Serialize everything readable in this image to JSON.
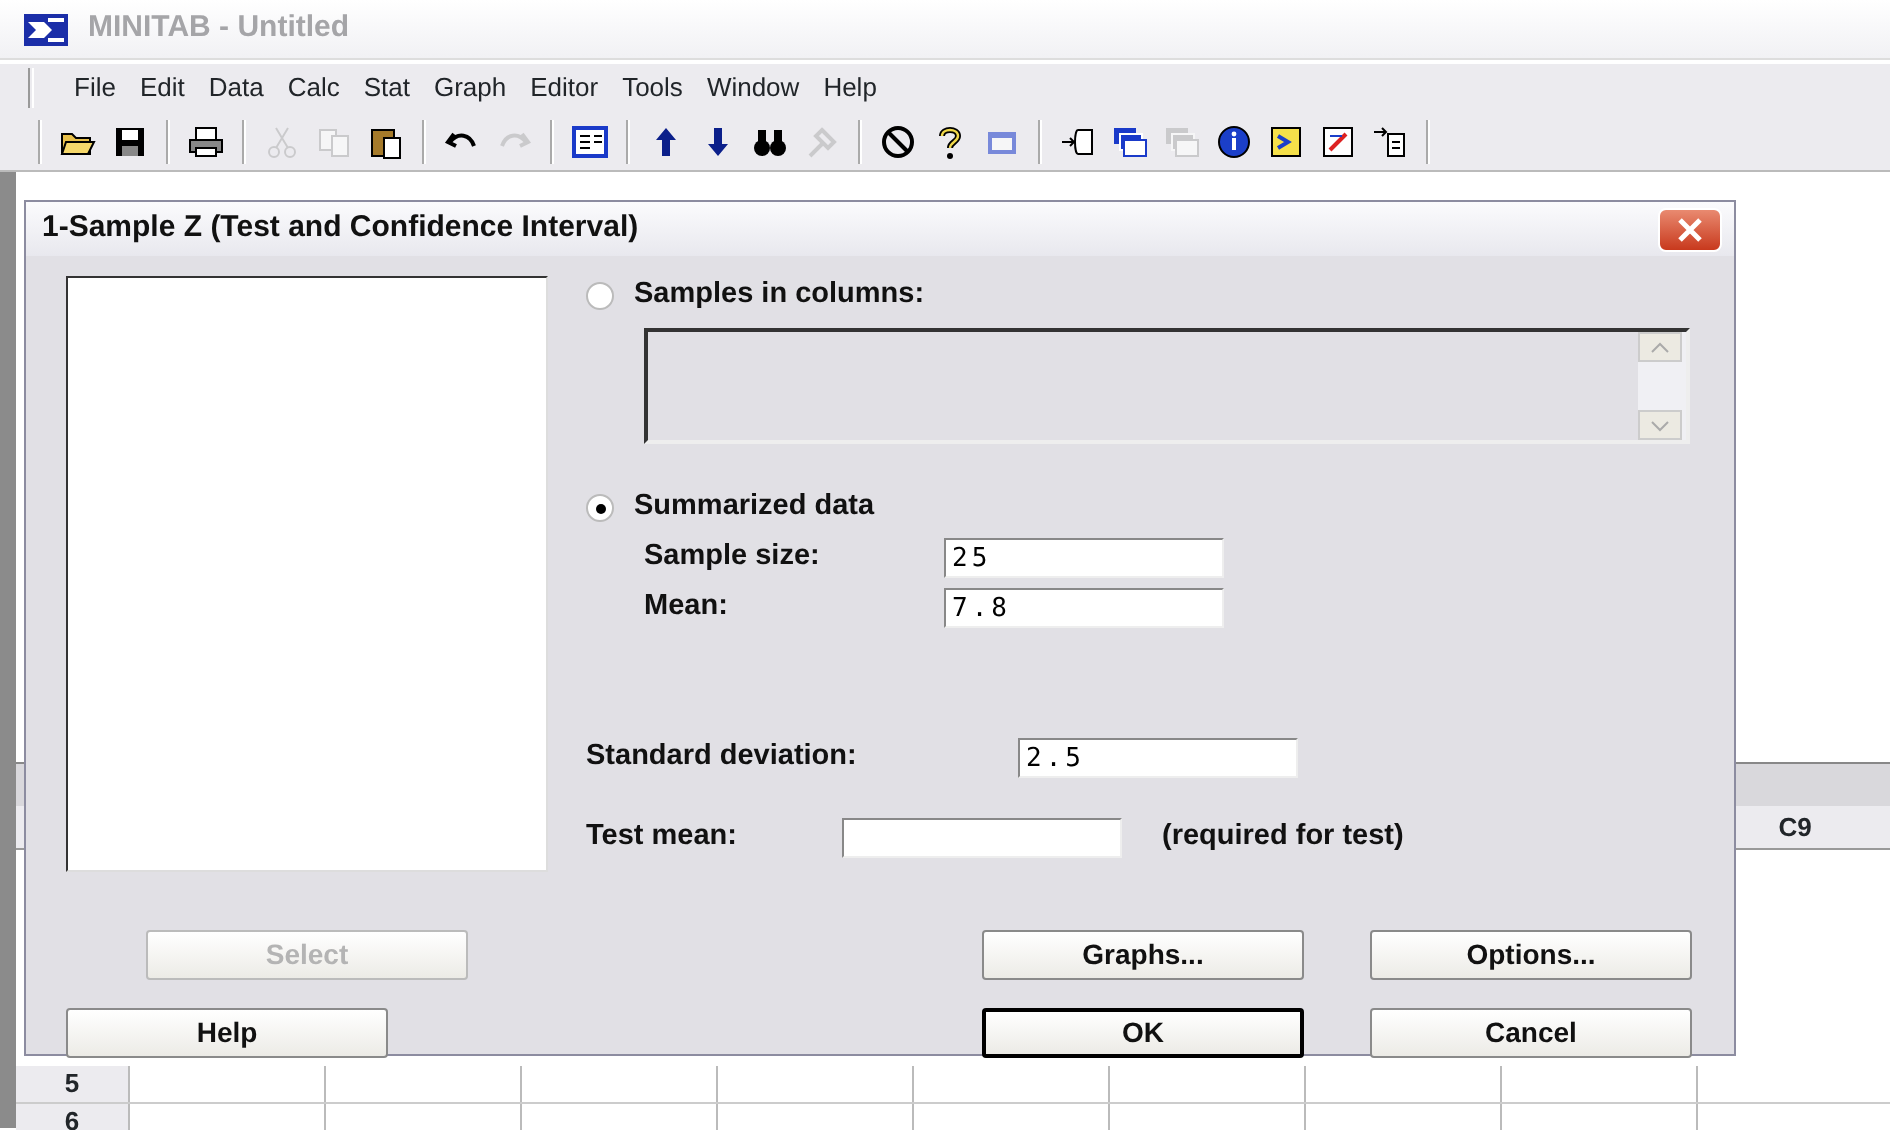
{
  "app_window": {
    "title": "MINITAB - Untitled"
  },
  "menu": [
    "File",
    "Edit",
    "Data",
    "Calc",
    "Stat",
    "Graph",
    "Editor",
    "Tools",
    "Window",
    "Help"
  ],
  "toolbar": [
    {
      "disabled": false
    },
    {
      "disabled": false
    },
    {
      "disabled": false
    },
    {
      "disabled": true
    },
    {
      "disabled": true
    },
    {
      "disabled": false
    },
    {
      "disabled": false
    },
    {
      "disabled": true
    },
    {
      "disabled": false
    },
    {
      "disabled": false
    },
    {
      "disabled": false
    },
    {
      "disabled": false
    },
    {
      "disabled": true
    },
    {
      "disabled": false
    },
    {
      "disabled": false
    },
    {
      "disabled": true
    },
    {
      "disabled": false
    },
    {
      "disabled": false
    },
    {
      "disabled": true
    },
    {
      "disabled": false
    },
    {
      "disabled": false
    },
    {
      "disabled": false
    },
    {
      "disabled": false
    }
  ],
  "worksheet": {
    "column_header": "C9",
    "row_labels": [
      "5",
      "6"
    ]
  },
  "dialog": {
    "title": "1-Sample Z (Test and Confidence Interval)",
    "options": [
      {
        "label": "Samples in columns:",
        "selected": false
      },
      {
        "label": "Summarized data",
        "selected": true
      }
    ],
    "sample_size": {
      "label": "Sample size:",
      "value": "25"
    },
    "mean": {
      "label": "Mean:",
      "value": "7.8"
    },
    "standard_deviation": {
      "label": "Standard deviation:",
      "value": "2.5"
    },
    "test_mean": {
      "label": "Test mean:",
      "note": "(required for test)"
    },
    "buttons": [
      {
        "label": "Select",
        "disabled": true,
        "default": false
      },
      {
        "label": "Graphs...",
        "disabled": false,
        "default": false
      },
      {
        "label": "Options...",
        "disabled": false,
        "default": false
      },
      {
        "label": "Help",
        "disabled": false,
        "default": false
      },
      {
        "label": "OK",
        "disabled": false,
        "default": true
      },
      {
        "label": "Cancel",
        "disabled": false,
        "default": false
      }
    ]
  }
}
